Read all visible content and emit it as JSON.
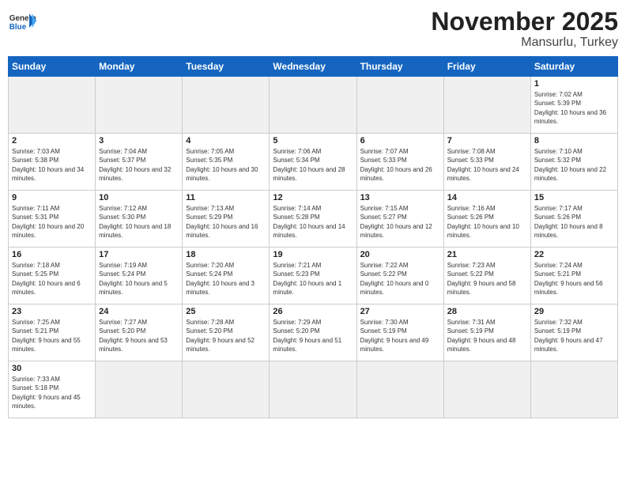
{
  "header": {
    "logo_general": "General",
    "logo_blue": "Blue",
    "month_title": "November 2025",
    "location": "Mansurlu, Turkey"
  },
  "days_of_week": [
    "Sunday",
    "Monday",
    "Tuesday",
    "Wednesday",
    "Thursday",
    "Friday",
    "Saturday"
  ],
  "weeks": [
    [
      {
        "day": "",
        "empty": true
      },
      {
        "day": "",
        "empty": true
      },
      {
        "day": "",
        "empty": true
      },
      {
        "day": "",
        "empty": true
      },
      {
        "day": "",
        "empty": true
      },
      {
        "day": "",
        "empty": true
      },
      {
        "day": "1",
        "sunrise": "7:02 AM",
        "sunset": "5:39 PM",
        "daylight": "10 hours and 36 minutes."
      }
    ],
    [
      {
        "day": "2",
        "sunrise": "7:03 AM",
        "sunset": "5:38 PM",
        "daylight": "10 hours and 34 minutes."
      },
      {
        "day": "3",
        "sunrise": "7:04 AM",
        "sunset": "5:37 PM",
        "daylight": "10 hours and 32 minutes."
      },
      {
        "day": "4",
        "sunrise": "7:05 AM",
        "sunset": "5:35 PM",
        "daylight": "10 hours and 30 minutes."
      },
      {
        "day": "5",
        "sunrise": "7:06 AM",
        "sunset": "5:34 PM",
        "daylight": "10 hours and 28 minutes."
      },
      {
        "day": "6",
        "sunrise": "7:07 AM",
        "sunset": "5:33 PM",
        "daylight": "10 hours and 26 minutes."
      },
      {
        "day": "7",
        "sunrise": "7:08 AM",
        "sunset": "5:33 PM",
        "daylight": "10 hours and 24 minutes."
      },
      {
        "day": "8",
        "sunrise": "7:10 AM",
        "sunset": "5:32 PM",
        "daylight": "10 hours and 22 minutes."
      }
    ],
    [
      {
        "day": "9",
        "sunrise": "7:11 AM",
        "sunset": "5:31 PM",
        "daylight": "10 hours and 20 minutes."
      },
      {
        "day": "10",
        "sunrise": "7:12 AM",
        "sunset": "5:30 PM",
        "daylight": "10 hours and 18 minutes."
      },
      {
        "day": "11",
        "sunrise": "7:13 AM",
        "sunset": "5:29 PM",
        "daylight": "10 hours and 16 minutes."
      },
      {
        "day": "12",
        "sunrise": "7:14 AM",
        "sunset": "5:28 PM",
        "daylight": "10 hours and 14 minutes."
      },
      {
        "day": "13",
        "sunrise": "7:15 AM",
        "sunset": "5:27 PM",
        "daylight": "10 hours and 12 minutes."
      },
      {
        "day": "14",
        "sunrise": "7:16 AM",
        "sunset": "5:26 PM",
        "daylight": "10 hours and 10 minutes."
      },
      {
        "day": "15",
        "sunrise": "7:17 AM",
        "sunset": "5:26 PM",
        "daylight": "10 hours and 8 minutes."
      }
    ],
    [
      {
        "day": "16",
        "sunrise": "7:18 AM",
        "sunset": "5:25 PM",
        "daylight": "10 hours and 6 minutes."
      },
      {
        "day": "17",
        "sunrise": "7:19 AM",
        "sunset": "5:24 PM",
        "daylight": "10 hours and 5 minutes."
      },
      {
        "day": "18",
        "sunrise": "7:20 AM",
        "sunset": "5:24 PM",
        "daylight": "10 hours and 3 minutes."
      },
      {
        "day": "19",
        "sunrise": "7:21 AM",
        "sunset": "5:23 PM",
        "daylight": "10 hours and 1 minute."
      },
      {
        "day": "20",
        "sunrise": "7:22 AM",
        "sunset": "5:22 PM",
        "daylight": "10 hours and 0 minutes."
      },
      {
        "day": "21",
        "sunrise": "7:23 AM",
        "sunset": "5:22 PM",
        "daylight": "9 hours and 58 minutes."
      },
      {
        "day": "22",
        "sunrise": "7:24 AM",
        "sunset": "5:21 PM",
        "daylight": "9 hours and 56 minutes."
      }
    ],
    [
      {
        "day": "23",
        "sunrise": "7:25 AM",
        "sunset": "5:21 PM",
        "daylight": "9 hours and 55 minutes."
      },
      {
        "day": "24",
        "sunrise": "7:27 AM",
        "sunset": "5:20 PM",
        "daylight": "9 hours and 53 minutes."
      },
      {
        "day": "25",
        "sunrise": "7:28 AM",
        "sunset": "5:20 PM",
        "daylight": "9 hours and 52 minutes."
      },
      {
        "day": "26",
        "sunrise": "7:29 AM",
        "sunset": "5:20 PM",
        "daylight": "9 hours and 51 minutes."
      },
      {
        "day": "27",
        "sunrise": "7:30 AM",
        "sunset": "5:19 PM",
        "daylight": "9 hours and 49 minutes."
      },
      {
        "day": "28",
        "sunrise": "7:31 AM",
        "sunset": "5:19 PM",
        "daylight": "9 hours and 48 minutes."
      },
      {
        "day": "29",
        "sunrise": "7:32 AM",
        "sunset": "5:19 PM",
        "daylight": "9 hours and 47 minutes."
      }
    ],
    [
      {
        "day": "30",
        "sunrise": "7:33 AM",
        "sunset": "5:18 PM",
        "daylight": "9 hours and 45 minutes."
      },
      {
        "day": "",
        "empty": true
      },
      {
        "day": "",
        "empty": true
      },
      {
        "day": "",
        "empty": true
      },
      {
        "day": "",
        "empty": true
      },
      {
        "day": "",
        "empty": true
      },
      {
        "day": "",
        "empty": true
      }
    ]
  ]
}
